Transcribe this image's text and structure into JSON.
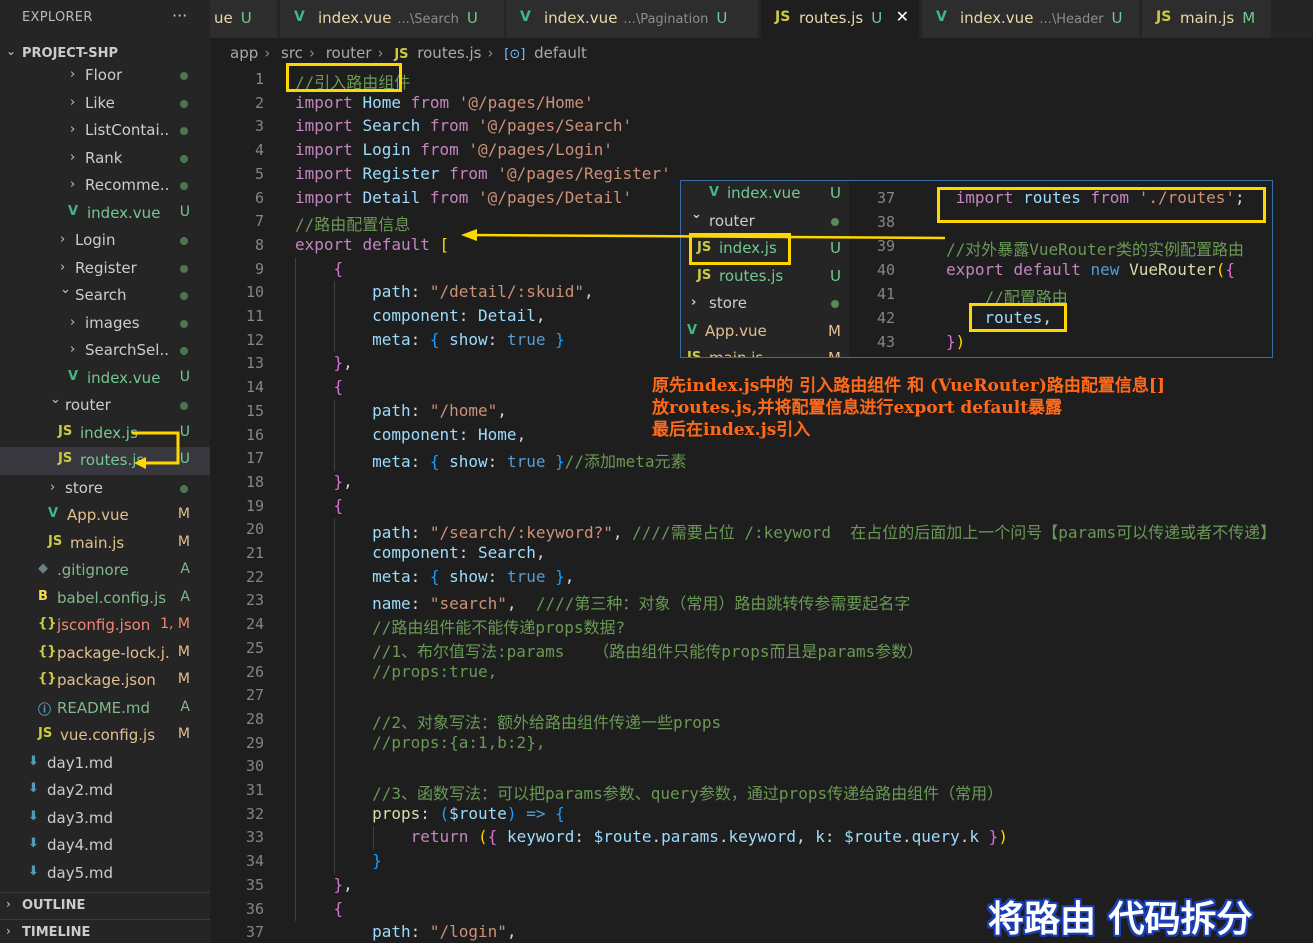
{
  "sidebar": {
    "title": "EXPLORER",
    "more": "···",
    "project": "PROJECT-SHP",
    "outline": "OUTLINE",
    "timeline": "TIMELINE",
    "items": [
      {
        "name": "Floor",
        "kind": "folder",
        "indent": 3,
        "status": "dot"
      },
      {
        "name": "Like",
        "kind": "folder",
        "indent": 3,
        "status": "dot"
      },
      {
        "name": "ListContai...",
        "kind": "folder",
        "indent": 3,
        "status": "dot"
      },
      {
        "name": "Rank",
        "kind": "folder",
        "indent": 3,
        "status": "dot"
      },
      {
        "name": "Recomme...",
        "kind": "folder",
        "indent": 3,
        "status": "dot"
      },
      {
        "name": "index.vue",
        "kind": "vue",
        "indent": 3,
        "status": "U"
      },
      {
        "name": "Login",
        "kind": "folder",
        "indent": 2,
        "status": "dot"
      },
      {
        "name": "Register",
        "kind": "folder",
        "indent": 2,
        "status": "dot"
      },
      {
        "name": "Search",
        "kind": "folder-open",
        "indent": 2,
        "status": "dot"
      },
      {
        "name": "images",
        "kind": "folder",
        "indent": 3,
        "status": "dot"
      },
      {
        "name": "SearchSel...",
        "kind": "folder",
        "indent": 3,
        "status": "dot"
      },
      {
        "name": "index.vue",
        "kind": "vue",
        "indent": 3,
        "status": "U"
      },
      {
        "name": "router",
        "kind": "folder-open",
        "indent": 1,
        "status": "dot"
      },
      {
        "name": "index.js",
        "kind": "js",
        "indent": 2,
        "status": "U"
      },
      {
        "name": "routes.js",
        "kind": "js",
        "indent": 2,
        "status": "U",
        "selected": true
      },
      {
        "name": "store",
        "kind": "folder",
        "indent": 1,
        "status": "dot"
      },
      {
        "name": "App.vue",
        "kind": "vue",
        "indent": 1,
        "status": "M"
      },
      {
        "name": "main.js",
        "kind": "js",
        "indent": 1,
        "status": "M"
      },
      {
        "name": ".gitignore",
        "kind": "git",
        "indent": 0,
        "status": "A"
      },
      {
        "name": "babel.config.js",
        "kind": "babel",
        "indent": 0,
        "status": "A"
      },
      {
        "name": "jsconfig.json",
        "kind": "json",
        "indent": 0,
        "status": "1, M",
        "error": true
      },
      {
        "name": "package-lock.j...",
        "kind": "json",
        "indent": 0,
        "status": "M"
      },
      {
        "name": "package.json",
        "kind": "json",
        "indent": 0,
        "status": "M"
      },
      {
        "name": "README.md",
        "kind": "info",
        "indent": 0,
        "status": "A"
      },
      {
        "name": "vue.config.js",
        "kind": "js",
        "indent": 0,
        "status": "M"
      },
      {
        "name": "day1.md",
        "kind": "md",
        "indent": -1,
        "status": ""
      },
      {
        "name": "day2.md",
        "kind": "md",
        "indent": -1,
        "status": ""
      },
      {
        "name": "day3.md",
        "kind": "md",
        "indent": -1,
        "status": ""
      },
      {
        "name": "day4.md",
        "kind": "md",
        "indent": -1,
        "status": ""
      },
      {
        "name": "day5.md",
        "kind": "md",
        "indent": -1,
        "status": ""
      }
    ]
  },
  "tabs": [
    {
      "icon": "vue",
      "name": "ue",
      "dir": "",
      "status": "U",
      "partial": true
    },
    {
      "icon": "vue",
      "name": "index.vue",
      "dir": "...\\Search",
      "status": "U"
    },
    {
      "icon": "vue",
      "name": "index.vue",
      "dir": "...\\Pagination",
      "status": "U"
    },
    {
      "icon": "js",
      "name": "routes.js",
      "dir": "",
      "status": "U",
      "active": true,
      "close": "✕"
    },
    {
      "icon": "vue",
      "name": "index.vue",
      "dir": "...\\Header",
      "status": "U"
    },
    {
      "icon": "js",
      "name": "main.js",
      "dir": "",
      "status": "M"
    }
  ],
  "breadcrumb": [
    "app",
    "src",
    "router",
    "routes.js",
    "default"
  ],
  "code_lines": [
    {
      "n": "1",
      "t": [
        [
          "cm",
          "//引入路由组件"
        ]
      ]
    },
    {
      "n": "2",
      "t": [
        [
          "k",
          "import"
        ],
        [
          "n",
          " "
        ],
        [
          "v",
          "Home"
        ],
        [
          "n",
          " "
        ],
        [
          "k",
          "from"
        ],
        [
          "n",
          " "
        ],
        [
          "s",
          "'@/pages/Home'"
        ]
      ]
    },
    {
      "n": "3",
      "t": [
        [
          "k",
          "import"
        ],
        [
          "n",
          " "
        ],
        [
          "v",
          "Search"
        ],
        [
          "n",
          " "
        ],
        [
          "k",
          "from"
        ],
        [
          "n",
          " "
        ],
        [
          "s",
          "'@/pages/Search'"
        ]
      ]
    },
    {
      "n": "4",
      "t": [
        [
          "k",
          "import"
        ],
        [
          "n",
          " "
        ],
        [
          "v",
          "Login"
        ],
        [
          "n",
          " "
        ],
        [
          "k",
          "from"
        ],
        [
          "n",
          " "
        ],
        [
          "s",
          "'@/pages/Login'"
        ]
      ]
    },
    {
      "n": "5",
      "t": [
        [
          "k",
          "import"
        ],
        [
          "n",
          " "
        ],
        [
          "v",
          "Register"
        ],
        [
          "n",
          " "
        ],
        [
          "k",
          "from"
        ],
        [
          "n",
          " "
        ],
        [
          "s",
          "'@/pages/Register'"
        ]
      ]
    },
    {
      "n": "6",
      "t": [
        [
          "k",
          "import"
        ],
        [
          "n",
          " "
        ],
        [
          "v",
          "Detail"
        ],
        [
          "n",
          " "
        ],
        [
          "k",
          "from"
        ],
        [
          "n",
          " "
        ],
        [
          "s",
          "'@/pages/Detail'"
        ]
      ]
    },
    {
      "n": "7",
      "t": [
        [
          "cm",
          "//路由配置信息"
        ]
      ]
    },
    {
      "n": "8",
      "t": [
        [
          "k",
          "export"
        ],
        [
          "n",
          " "
        ],
        [
          "k",
          "default"
        ],
        [
          "n",
          " "
        ],
        [
          "b1",
          "["
        ]
      ]
    },
    {
      "n": "9",
      "t": [
        [
          "n",
          "    "
        ],
        [
          "b2",
          "{"
        ]
      ]
    },
    {
      "n": "10",
      "t": [
        [
          "n",
          "        "
        ],
        [
          "v",
          "path"
        ],
        [
          "n",
          ": "
        ],
        [
          "s",
          "\"/detail/:skuid\""
        ],
        [
          "n",
          ","
        ]
      ]
    },
    {
      "n": "11",
      "t": [
        [
          "n",
          "        "
        ],
        [
          "v",
          "component"
        ],
        [
          "n",
          ": "
        ],
        [
          "v",
          "Detail"
        ],
        [
          "n",
          ","
        ]
      ]
    },
    {
      "n": "12",
      "t": [
        [
          "n",
          "        "
        ],
        [
          "v",
          "meta"
        ],
        [
          "n",
          ": "
        ],
        [
          "b3",
          "{"
        ],
        [
          "n",
          " "
        ],
        [
          "v",
          "show"
        ],
        [
          "n",
          ": "
        ],
        [
          "kb",
          "true"
        ],
        [
          "n",
          " "
        ],
        [
          "b3",
          "}"
        ]
      ]
    },
    {
      "n": "13",
      "t": [
        [
          "n",
          "    "
        ],
        [
          "b2",
          "}"
        ],
        [
          "n",
          ","
        ]
      ]
    },
    {
      "n": "14",
      "t": [
        [
          "n",
          "    "
        ],
        [
          "b2",
          "{"
        ]
      ]
    },
    {
      "n": "15",
      "t": [
        [
          "n",
          "        "
        ],
        [
          "v",
          "path"
        ],
        [
          "n",
          ": "
        ],
        [
          "s",
          "\"/home\""
        ],
        [
          "n",
          ","
        ]
      ]
    },
    {
      "n": "16",
      "t": [
        [
          "n",
          "        "
        ],
        [
          "v",
          "component"
        ],
        [
          "n",
          ": "
        ],
        [
          "v",
          "Home"
        ],
        [
          "n",
          ","
        ]
      ]
    },
    {
      "n": "17",
      "t": [
        [
          "n",
          "        "
        ],
        [
          "v",
          "meta"
        ],
        [
          "n",
          ": "
        ],
        [
          "b3",
          "{"
        ],
        [
          "n",
          " "
        ],
        [
          "v",
          "show"
        ],
        [
          "n",
          ": "
        ],
        [
          "kb",
          "true"
        ],
        [
          "n",
          " "
        ],
        [
          "b3",
          "}"
        ],
        [
          "cm",
          "//添加meta元素"
        ]
      ]
    },
    {
      "n": "18",
      "t": [
        [
          "n",
          "    "
        ],
        [
          "b2",
          "}"
        ],
        [
          "n",
          ","
        ]
      ]
    },
    {
      "n": "19",
      "t": [
        [
          "n",
          "    "
        ],
        [
          "b2",
          "{"
        ]
      ]
    },
    {
      "n": "20",
      "t": [
        [
          "n",
          "        "
        ],
        [
          "v",
          "path"
        ],
        [
          "n",
          ": "
        ],
        [
          "s",
          "\"/search/:keyword?\""
        ],
        [
          "n",
          ", "
        ],
        [
          "cm",
          "////需要占位 /:keyword  在占位的后面加上一个问号【params可以传递或者不传递】"
        ]
      ]
    },
    {
      "n": "21",
      "t": [
        [
          "n",
          "        "
        ],
        [
          "v",
          "component"
        ],
        [
          "n",
          ": "
        ],
        [
          "v",
          "Search"
        ],
        [
          "n",
          ","
        ]
      ]
    },
    {
      "n": "22",
      "t": [
        [
          "n",
          "        "
        ],
        [
          "v",
          "meta"
        ],
        [
          "n",
          ": "
        ],
        [
          "b3",
          "{"
        ],
        [
          "n",
          " "
        ],
        [
          "v",
          "show"
        ],
        [
          "n",
          ": "
        ],
        [
          "kb",
          "true"
        ],
        [
          "n",
          " "
        ],
        [
          "b3",
          "}"
        ],
        [
          "n",
          ","
        ]
      ]
    },
    {
      "n": "23",
      "t": [
        [
          "n",
          "        "
        ],
        [
          "v",
          "name"
        ],
        [
          "n",
          ": "
        ],
        [
          "s",
          "\"search\""
        ],
        [
          "n",
          ",  "
        ],
        [
          "cm",
          "////第三种：对象（常用）路由跳转传参需要起名字"
        ]
      ]
    },
    {
      "n": "24",
      "t": [
        [
          "n",
          "        "
        ],
        [
          "cm",
          "//路由组件能不能传递props数据?"
        ]
      ]
    },
    {
      "n": "25",
      "t": [
        [
          "n",
          "        "
        ],
        [
          "cm",
          "//1、布尔值写法:params   （路由组件只能传props而且是params参数）"
        ]
      ]
    },
    {
      "n": "26",
      "t": [
        [
          "n",
          "        "
        ],
        [
          "cm",
          "//props:true,"
        ]
      ]
    },
    {
      "n": "27",
      "t": []
    },
    {
      "n": "28",
      "t": [
        [
          "n",
          "        "
        ],
        [
          "cm",
          "//2、对象写法：额外给路由组件传递一些props"
        ]
      ]
    },
    {
      "n": "29",
      "t": [
        [
          "n",
          "        "
        ],
        [
          "cm",
          "//props:{a:1,b:2},"
        ]
      ]
    },
    {
      "n": "30",
      "t": []
    },
    {
      "n": "31",
      "t": [
        [
          "n",
          "        "
        ],
        [
          "cm",
          "//3、函数写法：可以把params参数、query参数，通过props传递给路由组件（常用）"
        ]
      ]
    },
    {
      "n": "32",
      "t": [
        [
          "n",
          "        "
        ],
        [
          "f",
          "props"
        ],
        [
          "n",
          ": "
        ],
        [
          "b3",
          "("
        ],
        [
          "v",
          "$route"
        ],
        [
          "b3",
          ")"
        ],
        [
          "n",
          " "
        ],
        [
          "kb",
          "=>"
        ],
        [
          "n",
          " "
        ],
        [
          "b3",
          "{"
        ]
      ]
    },
    {
      "n": "33",
      "t": [
        [
          "n",
          "            "
        ],
        [
          "k",
          "return"
        ],
        [
          "n",
          " "
        ],
        [
          "b1",
          "("
        ],
        [
          "b2",
          "{"
        ],
        [
          "n",
          " "
        ],
        [
          "v",
          "keyword"
        ],
        [
          "n",
          ": "
        ],
        [
          "v",
          "$route"
        ],
        [
          "n",
          "."
        ],
        [
          "v",
          "params"
        ],
        [
          "n",
          "."
        ],
        [
          "v",
          "keyword"
        ],
        [
          "n",
          ", "
        ],
        [
          "v",
          "k"
        ],
        [
          "n",
          ": "
        ],
        [
          "v",
          "$route"
        ],
        [
          "n",
          "."
        ],
        [
          "v",
          "query"
        ],
        [
          "n",
          "."
        ],
        [
          "v",
          "k"
        ],
        [
          "n",
          " "
        ],
        [
          "b2",
          "}"
        ],
        [
          "b1",
          ")"
        ]
      ]
    },
    {
      "n": "34",
      "t": [
        [
          "n",
          "        "
        ],
        [
          "b3",
          "}"
        ]
      ]
    },
    {
      "n": "35",
      "t": [
        [
          "n",
          "    "
        ],
        [
          "b2",
          "}"
        ],
        [
          "n",
          ","
        ]
      ]
    },
    {
      "n": "36",
      "t": [
        [
          "n",
          "    "
        ],
        [
          "b2",
          "{"
        ]
      ]
    },
    {
      "n": "37",
      "t": [
        [
          "n",
          "        "
        ],
        [
          "v",
          "path"
        ],
        [
          "n",
          ": "
        ],
        [
          "s",
          "\"/login\""
        ],
        [
          "n",
          ","
        ]
      ]
    }
  ],
  "overlay": {
    "tree": [
      {
        "name": "index.vue",
        "kind": "vue",
        "status": "U"
      },
      {
        "name": "router",
        "kind": "folder-open",
        "status": "dot"
      },
      {
        "name": "index.js",
        "kind": "js",
        "status": "U"
      },
      {
        "name": "routes.js",
        "kind": "js",
        "status": "U"
      },
      {
        "name": "store",
        "kind": "folder",
        "status": "dot"
      },
      {
        "name": "App.vue",
        "kind": "vue",
        "status": "M"
      },
      {
        "name": "main.js",
        "kind": "js",
        "status": "M"
      }
    ],
    "code": [
      {
        "n": "37",
        "t": [
          [
            "n",
            " "
          ],
          [
            "k",
            "import"
          ],
          [
            "n",
            " "
          ],
          [
            "v",
            "routes"
          ],
          [
            "n",
            " "
          ],
          [
            "k",
            "from"
          ],
          [
            "n",
            " "
          ],
          [
            "s",
            "'./routes'"
          ],
          [
            "n",
            ";"
          ]
        ]
      },
      {
        "n": "38",
        "t": []
      },
      {
        "n": "39",
        "t": [
          [
            "cm",
            "//对外暴露VueRouter类的实例配置路由"
          ]
        ]
      },
      {
        "n": "40",
        "t": [
          [
            "k",
            "export"
          ],
          [
            "n",
            " "
          ],
          [
            "k",
            "default"
          ],
          [
            "n",
            " "
          ],
          [
            "kb",
            "new"
          ],
          [
            "n",
            " "
          ],
          [
            "f",
            "VueRouter"
          ],
          [
            "b1",
            "("
          ],
          [
            "b2",
            "{"
          ]
        ]
      },
      {
        "n": "41",
        "t": [
          [
            "n",
            "    "
          ],
          [
            "cm",
            "//配置路由"
          ]
        ]
      },
      {
        "n": "42",
        "t": [
          [
            "n",
            "    "
          ],
          [
            "v",
            "routes"
          ],
          [
            "n",
            ","
          ]
        ]
      },
      {
        "n": "43",
        "t": [
          [
            "b2",
            "}"
          ],
          [
            "b1",
            ")"
          ]
        ]
      }
    ]
  },
  "annotation": {
    "lines": [
      "原先index.js中的 引入路由组件 和 (VueRouter)路由配置信息[]",
      "放routes.js,并将配置信息进行export default暴露",
      "最后在index.js引入"
    ],
    "caption": "将路由 代码拆分"
  },
  "colors": {
    "highlight": "#ffd700",
    "annotation": "#ff6a1a",
    "caption_outline": "#1a3fb5",
    "overlay_border": "#3a6ea5"
  }
}
